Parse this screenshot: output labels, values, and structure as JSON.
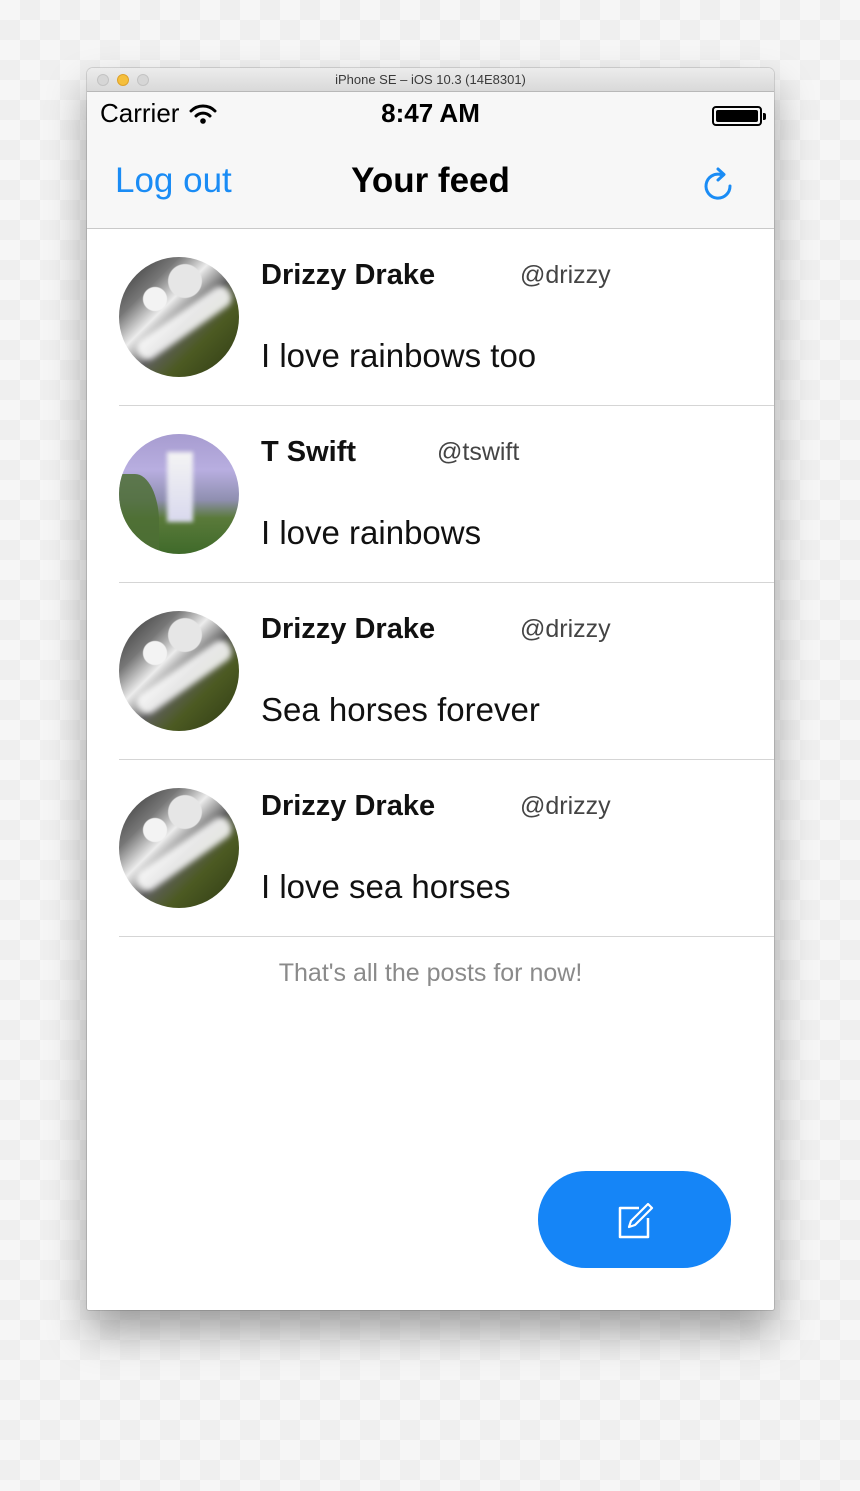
{
  "window": {
    "title": "iPhone SE – iOS 10.3 (14E8301)"
  },
  "status_bar": {
    "carrier": "Carrier",
    "time": "8:47 AM"
  },
  "nav": {
    "left_label": "Log out",
    "title": "Your feed",
    "right_icon": "refresh-icon"
  },
  "posts": [
    {
      "name": "Drizzy Drake",
      "handle": "@drizzy",
      "message": "I love rainbows too",
      "avatar": "waterfall-bw"
    },
    {
      "name": "T Swift",
      "handle": "@tswift",
      "message": "I love rainbows",
      "avatar": "waterfall-green"
    },
    {
      "name": "Drizzy Drake",
      "handle": "@drizzy",
      "message": "Sea horses forever",
      "avatar": "waterfall-bw"
    },
    {
      "name": "Drizzy Drake",
      "handle": "@drizzy",
      "message": "I love sea horses",
      "avatar": "waterfall-bw"
    }
  ],
  "feed_end_note": "That's all the posts for now!",
  "compose_button": {
    "icon": "compose-icon"
  },
  "colors": {
    "accent": "#1a8cf5",
    "compose_bg": "#1585f7",
    "nav_bg": "#f7f7f7"
  }
}
